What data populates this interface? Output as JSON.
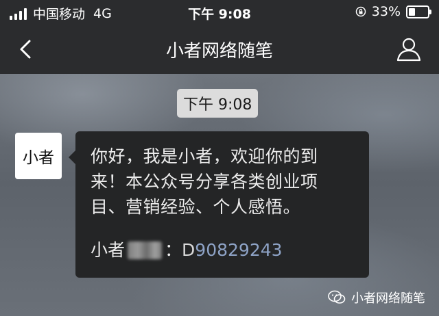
{
  "status_bar": {
    "carrier": "中国移动",
    "network": "4G",
    "time": "下午 9:08",
    "battery_percent": "33%",
    "battery_level": 0.33,
    "icons": [
      "signal-icon",
      "orientation-lock-icon",
      "battery-icon"
    ]
  },
  "nav": {
    "title": "小者网络随笔",
    "icons": [
      "back-icon",
      "profile-icon"
    ]
  },
  "chat": {
    "timestamp": "下午 9:08",
    "avatar_text": "小者",
    "message": {
      "lines": [
        "你好，我是小者，欢迎你的到",
        "来！本公众号分享各类创业项",
        "目、营销经验、个人感悟。"
      ],
      "contact_prefix": "小者",
      "contact_colon": "：",
      "contact_letter": "D",
      "contact_number": "90829243"
    }
  },
  "watermark": {
    "text": "小者网络随笔",
    "icon": "wechat-icon"
  },
  "colors": {
    "bar_bg": "#2b2c2e",
    "bubble_bg": "#242526",
    "link_number": "#8ea3c6",
    "timestamp_bg": "#dcdcdc"
  }
}
